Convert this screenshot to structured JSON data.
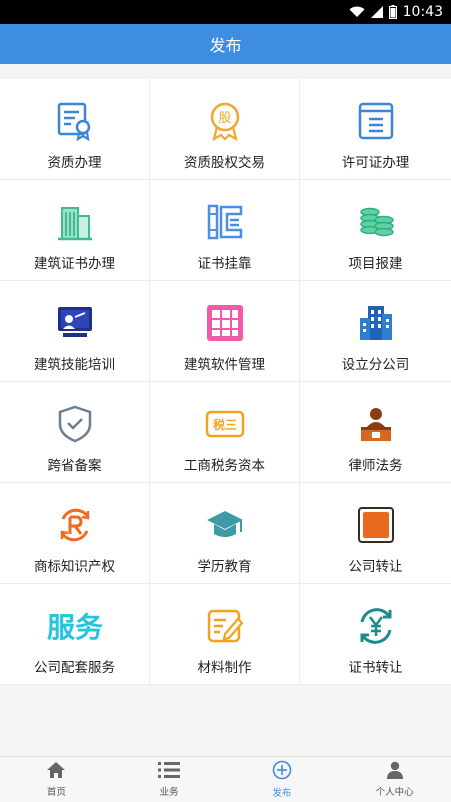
{
  "status": {
    "time": "10:43"
  },
  "header": {
    "title": "发布"
  },
  "items": [
    {
      "label": "资质办理",
      "icon": "certificate-icon"
    },
    {
      "label": "资质股权交易",
      "icon": "stock-badge-icon"
    },
    {
      "label": "许可证办理",
      "icon": "license-document-icon"
    },
    {
      "label": "建筑证书办理",
      "icon": "building-certificate-icon"
    },
    {
      "label": "证书挂靠",
      "icon": "bookshelf-icon"
    },
    {
      "label": "项目报建",
      "icon": "coin-stack-icon"
    },
    {
      "label": "建筑技能培训",
      "icon": "training-board-icon"
    },
    {
      "label": "建筑软件管理",
      "icon": "software-grid-icon"
    },
    {
      "label": "设立分公司",
      "icon": "office-building-icon"
    },
    {
      "label": "跨省备案",
      "icon": "shield-check-icon"
    },
    {
      "label": "工商税务资本",
      "icon": "tax-icon"
    },
    {
      "label": "律师法务",
      "icon": "lawyer-icon"
    },
    {
      "label": "商标知识产权",
      "icon": "trademark-icon"
    },
    {
      "label": "学历教育",
      "icon": "graduation-cap-icon"
    },
    {
      "label": "公司转让",
      "icon": "company-transfer-icon"
    },
    {
      "label": "公司配套服务",
      "icon": "service-text-icon"
    },
    {
      "label": "材料制作",
      "icon": "edit-document-icon"
    },
    {
      "label": "证书转让",
      "icon": "yuan-exchange-icon"
    }
  ],
  "icon_text": {
    "stock": "股",
    "tax": "税三",
    "service": "服务"
  },
  "tabs": [
    {
      "label": "首页",
      "icon": "home-icon",
      "active": false
    },
    {
      "label": "业务",
      "icon": "list-icon",
      "active": false
    },
    {
      "label": "发布",
      "icon": "add-circle-icon",
      "active": true
    },
    {
      "label": "个人中心",
      "icon": "person-icon",
      "active": false
    }
  ],
  "colors": {
    "header": "#3d8de0",
    "active_tab": "#3d8de0",
    "status_bar": "#000000"
  }
}
